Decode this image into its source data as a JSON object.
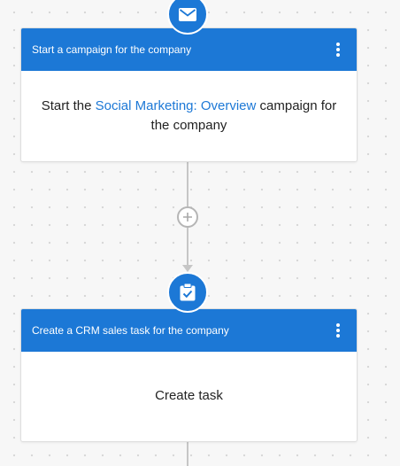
{
  "colors": {
    "accent": "#1c78d6",
    "connector": "#c6c6c6",
    "canvas": "#f7f7f7"
  },
  "actions": [
    {
      "icon": "envelope-icon",
      "title": "Start a campaign for the company",
      "body_prefix": "Start the",
      "body_link": "Social Marketing: Overview",
      "body_suffix": "campaign for the company"
    },
    {
      "icon": "clipboard-check-icon",
      "title": "Create a CRM sales task for the company",
      "body": "Create task"
    }
  ],
  "add_step_icon": "plus-icon",
  "more_options_icon": "kebab-menu-icon"
}
